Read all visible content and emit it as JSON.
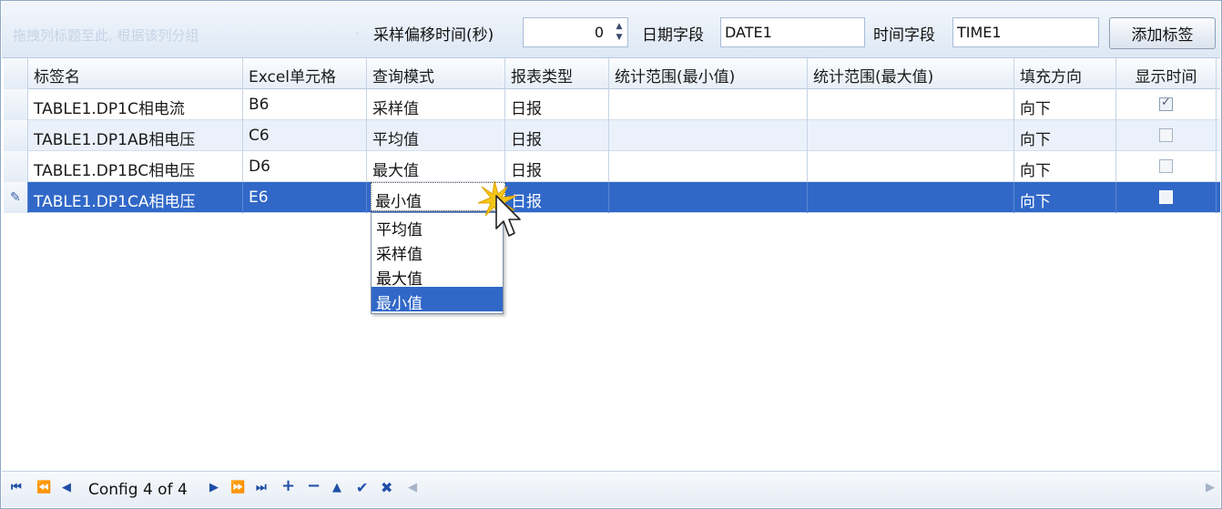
{
  "toolbar": {
    "faded_hint": "拖拽列标题至此, 根据该列分组",
    "faded_mark": "·",
    "offset_label": "采样偏移时间(秒)",
    "offset_value": "0",
    "date_label": "日期字段",
    "date_value": "DATE1",
    "time_label": "时间字段",
    "time_value": "TIME1",
    "add_button": "添加标签"
  },
  "grid": {
    "columns": [
      "标签名",
      "Excel单元格",
      "查询模式",
      "报表类型",
      "统计范围(最小值)",
      "统计范围(最大值)",
      "填充方向",
      "显示时间"
    ],
    "rows": [
      {
        "tag": "TABLE1.DP1C相电流",
        "cell": "B6",
        "mode": "采样值",
        "type": "日报",
        "min": "",
        "max": "",
        "fill": "向下",
        "show_time": true
      },
      {
        "tag": "TABLE1.DP1AB相电压",
        "cell": "C6",
        "mode": "平均值",
        "type": "日报",
        "min": "",
        "max": "",
        "fill": "向下",
        "show_time": false
      },
      {
        "tag": "TABLE1.DP1BC相电压",
        "cell": "D6",
        "mode": "最大值",
        "type": "日报",
        "min": "",
        "max": "",
        "fill": "向下",
        "show_time": false
      },
      {
        "tag": "TABLE1.DP1CA相电压",
        "cell": "E6",
        "mode": "最小值",
        "type": "日报",
        "min": "",
        "max": "",
        "fill": "向下",
        "show_time": false
      }
    ],
    "selected_row": 3,
    "editor": {
      "value": "最小值",
      "options": [
        "平均值",
        "采样值",
        "最大值",
        "最小值"
      ],
      "highlighted": "最小值"
    }
  },
  "navigator": {
    "record_text": "Config 4 of 4"
  },
  "colors": {
    "selection": "#3168c8",
    "alt_row": "#eaf1fb",
    "toolbar_bg": "#dde8f5"
  }
}
